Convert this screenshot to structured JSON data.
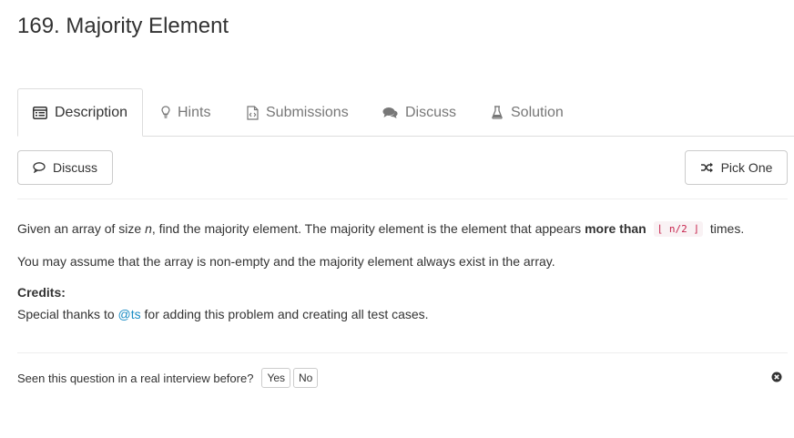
{
  "page": {
    "title": "169. Majority Element"
  },
  "tabs": [
    {
      "label": "Description",
      "icon": "list-alt-icon",
      "active": true
    },
    {
      "label": "Hints",
      "icon": "lightbulb-icon"
    },
    {
      "label": "Submissions",
      "icon": "code-file-icon"
    },
    {
      "label": "Discuss",
      "icon": "comments-icon"
    },
    {
      "label": "Solution",
      "icon": "flask-icon"
    }
  ],
  "toolbar": {
    "discuss_label": "Discuss",
    "pick_one_label": "Pick One"
  },
  "description": {
    "p1_prefix": "Given an array of size ",
    "p1_var": "n",
    "p1_mid": ", find the majority element. The majority element is the element that appears ",
    "p1_bold": "more than",
    "p1_code": "⌊ n/2 ⌋",
    "p1_suffix": " times.",
    "p2": "You may assume that the array is non-empty and the majority element always exist in the array.",
    "credits_label": "Credits:",
    "credits_prefix": "Special thanks to ",
    "credits_link": "@ts",
    "credits_suffix": " for adding this problem and creating all test cases."
  },
  "feedback": {
    "question": "Seen this question in a real interview before?",
    "yes_label": "Yes",
    "no_label": "No"
  },
  "colors": {
    "link": "#1a8cc4",
    "code_text": "#c7254e",
    "code_bg": "#f9f2f4"
  }
}
